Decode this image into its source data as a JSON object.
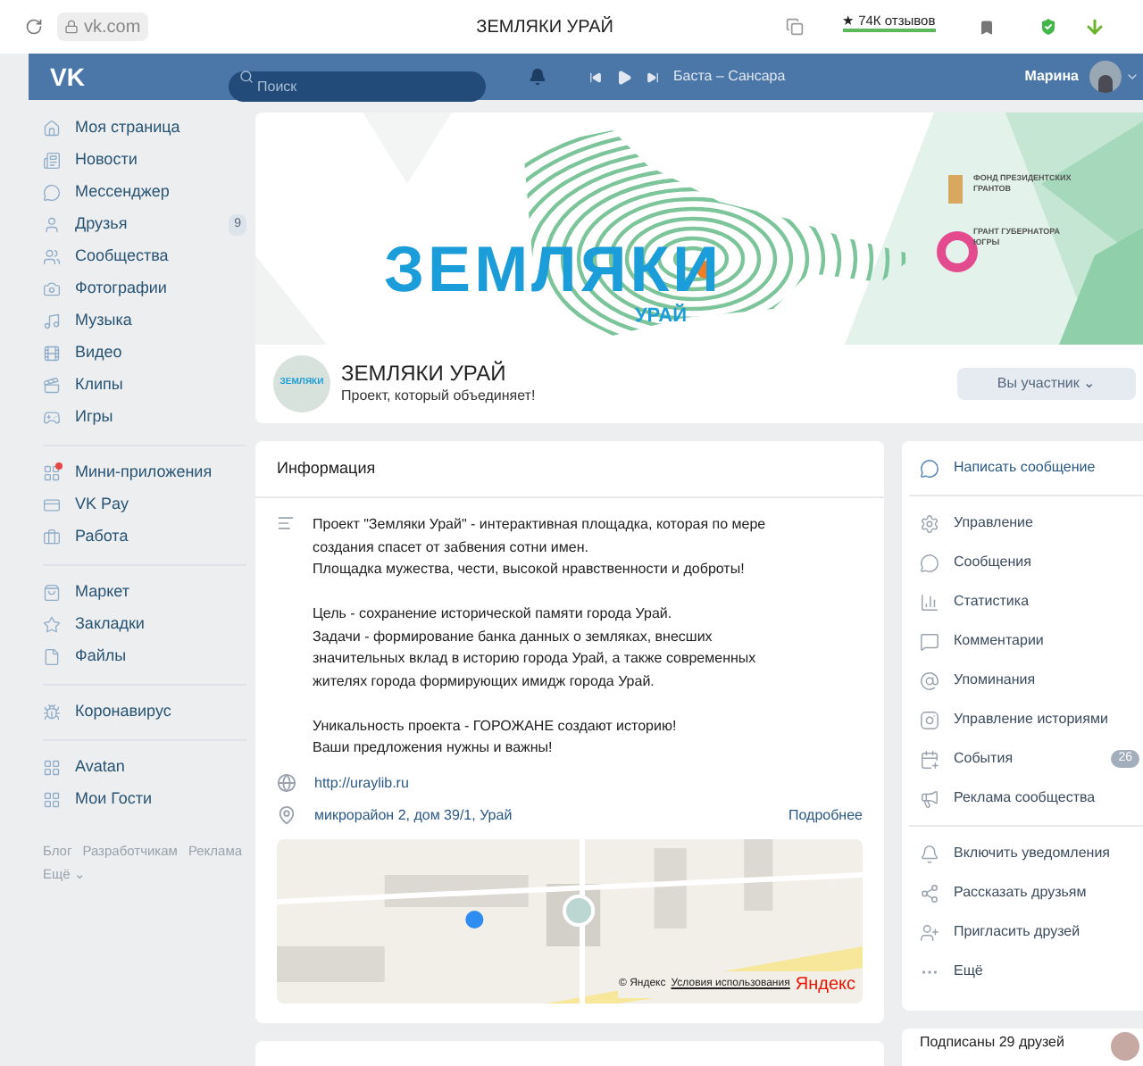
{
  "browser": {
    "address": "vk.com",
    "title": "ЗЕМЛЯКИ УРАЙ",
    "reviews": "★ 74К отзывов"
  },
  "header": {
    "logo": "VK",
    "search": {
      "placeholder": "Поиск"
    },
    "track": "Баста – Сансара",
    "user": "Марина"
  },
  "sidebar": {
    "groups": [
      [
        {
          "label": "Моя страница"
        },
        {
          "label": "Новости"
        },
        {
          "label": "Мессенджер"
        },
        {
          "label": "Друзья",
          "count": "9"
        },
        {
          "label": "Сообщества"
        },
        {
          "label": "Фотографии"
        },
        {
          "label": "Музыка"
        },
        {
          "label": "Видео"
        },
        {
          "label": "Клипы"
        },
        {
          "label": "Игры"
        }
      ],
      [
        {
          "label": "Мини-приложения",
          "dot": true
        },
        {
          "label": "VK Pay",
          "dot": false
        },
        {
          "label": "Работа",
          "dot": false
        }
      ],
      [
        {
          "label": "Маркет"
        },
        {
          "label": "Закладки"
        },
        {
          "label": "Файлы"
        }
      ],
      [
        {
          "label": "Коронавирус"
        }
      ],
      [
        {
          "label": "Avatan"
        },
        {
          "label": "Мои Гости"
        }
      ]
    ],
    "footer": [
      "Блог",
      "Разработчикам",
      "Реклама",
      "Ещё ⌄"
    ]
  },
  "cover": {
    "logo_text": "ЗЕМЛЯКИ",
    "logo_sub": "УРАЙ",
    "sponsors": [
      "ФОНД ПРЕЗИДЕНТСКИХ ГРАНТОВ",
      "ГРАНТ ГУБЕРНАТОРА ЮГРЫ"
    ]
  },
  "group": {
    "avatar_text": "ЗЕМЛЯКИ",
    "name": "ЗЕМЛЯКИ УРАЙ",
    "status": "Проект, который объединяет!",
    "member_button": "Вы участник ⌄"
  },
  "info": {
    "title": "Информация",
    "description": "Проект \"Земляки Урай\" - интерактивная площадка, которая по мере\nсоздания спасет от забвения сотни имен.\nПлощадка мужества, чести, высокой нравственности и доброты!\n\nЦель - сохранение исторической памяти города Урай.\nЗадачи - формирование банка данных о земляках, внесших\nзначительных вклад в историю города Урай, а также современных\nжителях города формирующих имидж города Урай.\n\nУникальность проекта - ГОРОЖАНЕ создают историю!\nВаши предложения нужны и важны!",
    "website": "http://uraylib.ru",
    "address": "микрорайон 2, дом 39/1, Урай",
    "more": "Подробнее",
    "map": {
      "copyright": "© Яндекс",
      "terms": "Условия использования",
      "brand": "Яндекс"
    }
  },
  "actions": [
    [
      {
        "label": "Написать сообщение",
        "primary": true
      }
    ],
    [
      {
        "label": "Управление",
        "primary": false
      },
      {
        "label": "Сообщения",
        "primary": false
      },
      {
        "label": "Статистика",
        "primary": false
      },
      {
        "label": "Комментарии",
        "primary": false
      },
      {
        "label": "Упоминания",
        "primary": false
      },
      {
        "label": "Управление историями",
        "primary": false
      },
      {
        "label": "События",
        "primary": false,
        "count": "26"
      },
      {
        "label": "Реклама сообщества",
        "primary": false
      }
    ],
    [
      {
        "label": "Включить уведомления",
        "primary": false
      },
      {
        "label": "Рассказать друзьям",
        "primary": false
      },
      {
        "label": "Пригласить друзей",
        "primary": false
      },
      {
        "label": "Ещё",
        "primary": false
      }
    ]
  ],
  "friends": {
    "label": "Подписаны 29 друзей"
  }
}
